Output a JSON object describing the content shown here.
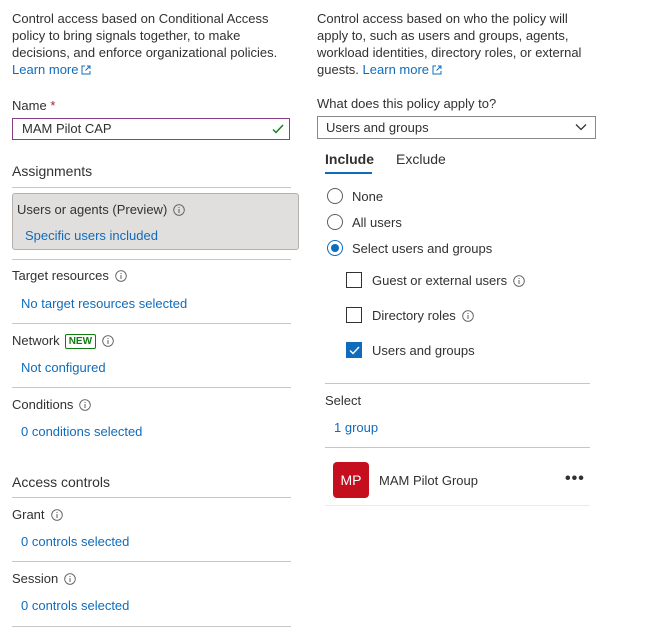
{
  "left": {
    "description": "Control access based on Conditional Access policy to bring signals together, to make decisions, and enforce organizational policies.",
    "learn_more": "Learn more",
    "name_label": "Name",
    "name_required": "*",
    "name_value": "MAM Pilot CAP",
    "assignments_header": "Assignments",
    "users_label": "Users or agents (Preview)",
    "users_value": "Specific users included",
    "target_label": "Target resources",
    "target_value": "No target resources selected",
    "network_label": "Network",
    "network_badge": "NEW",
    "network_value": "Not configured",
    "conditions_label": "Conditions",
    "conditions_value": "0 conditions selected",
    "access_header": "Access controls",
    "grant_label": "Grant",
    "grant_value": "0 controls selected",
    "session_label": "Session",
    "session_value": "0 controls selected"
  },
  "right": {
    "desc_line1": "Control access based on who the policy will",
    "desc_line2": "apply to, such as users and groups, agents,",
    "desc_line3": "workload identities, directory roles, or external",
    "desc_line4": "guests.",
    "learn_more": "Learn more",
    "apply_label": "What does this policy apply to?",
    "apply_value": "Users and groups",
    "tabs": {
      "include": "Include",
      "exclude": "Exclude"
    },
    "radio": {
      "none": "None",
      "all": "All users",
      "select": "Select users and groups"
    },
    "checks": {
      "guest": "Guest or external users",
      "directory": "Directory roles",
      "users_groups": "Users and groups"
    },
    "select_label": "Select",
    "select_value": "1 group",
    "group": {
      "initials": "MP",
      "name": "MAM Pilot Group",
      "more": "•••"
    }
  },
  "colors": {
    "accent": "#0f6cbd",
    "avatar": "#c50f1f",
    "badge": "#107c10"
  }
}
